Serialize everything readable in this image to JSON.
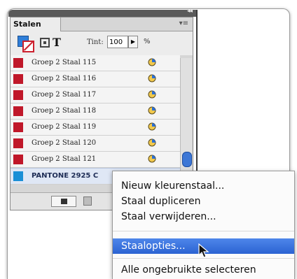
{
  "panel": {
    "tab_label": "Stalen",
    "tint_label": "Tint:",
    "tint_value": "100",
    "tint_unit": "%",
    "swatches": [
      {
        "name": "Groep 2 Staal 115",
        "color": "#c0182a"
      },
      {
        "name": "Groep 2 Staal 116",
        "color": "#c0182a"
      },
      {
        "name": "Groep 2 Staal 117",
        "color": "#c0182a"
      },
      {
        "name": "Groep 2 Staal 118",
        "color": "#c0182a"
      },
      {
        "name": "Groep 2 Staal 119",
        "color": "#c0182a"
      },
      {
        "name": "Groep 2 Staal 120",
        "color": "#c0182a"
      },
      {
        "name": "Groep 2 Staal 121",
        "color": "#c0182a"
      },
      {
        "name": "PANTONE 2925 C",
        "color": "#1a8fd6",
        "selected": true
      }
    ]
  },
  "context_menu": {
    "items": [
      {
        "label": "Nieuw kleurenstaal..."
      },
      {
        "label": "Staal dupliceren"
      },
      {
        "label": "Staal verwijderen..."
      },
      {
        "label": "Staalopties...",
        "highlighted": true
      },
      {
        "label": "Alle ongebruikte selecteren"
      }
    ]
  },
  "colors": {
    "accent": "#2b63d2",
    "swatch_red": "#c0182a",
    "swatch_blue": "#1a8fd6"
  }
}
